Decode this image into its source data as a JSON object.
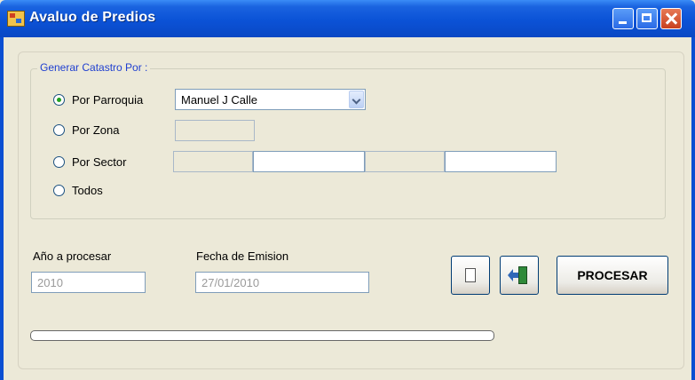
{
  "window": {
    "title": "Avaluo de Predios",
    "controls": {
      "minimize": "minimize-icon",
      "maximize": "maximize-icon",
      "close": "close-icon"
    }
  },
  "group": {
    "legend": "Generar Catastro Por :",
    "options": [
      {
        "label": "Por Parroquia",
        "checked": true
      },
      {
        "label": "Por Zona",
        "checked": false
      },
      {
        "label": "Por Sector",
        "checked": false
      },
      {
        "label": "Todos",
        "checked": false
      }
    ],
    "parroquia_select": {
      "selected": "Manuel J Calle"
    }
  },
  "year": {
    "label": "Año a procesar",
    "value": "2010"
  },
  "fecha": {
    "label": "Fecha de Emision",
    "value": "27/01/2010"
  },
  "buttons": {
    "paste_icon": "paste-icon",
    "exit_icon": "exit-door-icon",
    "procesar": "PROCESAR"
  },
  "progress": {
    "value": 0
  },
  "colors": {
    "titlebar": "#0b52d6",
    "legend": "#1f3fd0",
    "window": "#ece9d8"
  }
}
